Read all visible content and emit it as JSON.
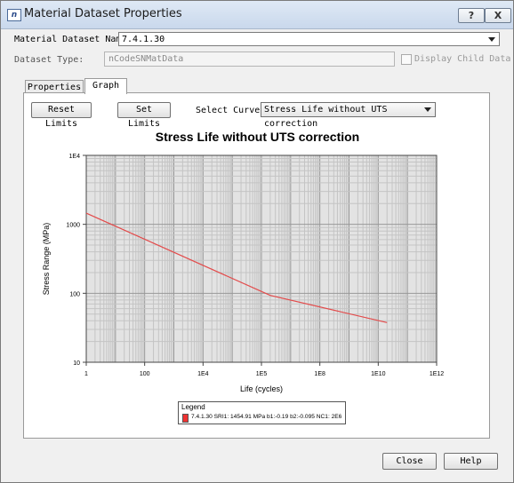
{
  "window": {
    "title": "Material Dataset Properties",
    "help_button": "?",
    "close_button": "X"
  },
  "form": {
    "dataset_name_label": "Material Dataset Name:",
    "dataset_name_value": "7.4.1.30",
    "dataset_type_label": "Dataset Type:",
    "dataset_type_value": "nCodeSNMatData",
    "display_child_label": "Display Child Data",
    "display_child_checked": false
  },
  "tabs": [
    {
      "label": "Properties",
      "active": false
    },
    {
      "label": "Graph",
      "active": true
    }
  ],
  "graph_toolbar": {
    "reset_limits": "Reset Limits",
    "set_limits": "Set Limits",
    "select_curve_label": "Select Curve",
    "select_curve_value": "Stress Life without UTS correction"
  },
  "chart_data": {
    "type": "line",
    "title": "Stress Life without UTS correction",
    "xlabel": "Life (cycles)",
    "ylabel": "Stress Range (MPa)",
    "x_scale": "log",
    "y_scale": "log",
    "xlim": [
      1,
      1000000000000
    ],
    "ylim": [
      10,
      10000
    ],
    "x_ticks": [
      "1",
      "100",
      "1E4",
      "1E5",
      "1E8",
      "1E10",
      "1E12"
    ],
    "y_ticks": [
      "10",
      "100",
      "1000",
      "1E4"
    ],
    "grid": true,
    "series": [
      {
        "name": "7.4.1.30 SRI1: 1454.91 MPa  b1:-0.19 b2:-0.095 NC1: 2E6",
        "color": "#e34a4a",
        "x": [
          1,
          2000000,
          20000000000
        ],
        "y": [
          1454.91,
          93.2,
          37.6
        ]
      }
    ],
    "legend": {
      "title": "Legend",
      "placement": "bottom-center"
    }
  },
  "footer": {
    "close_label": "Close",
    "help_label": "Help"
  }
}
